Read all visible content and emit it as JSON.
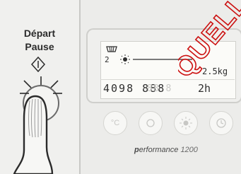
{
  "start_pause": {
    "line1": "Départ",
    "line2": "Pause"
  },
  "display": {
    "program_number": "2",
    "weight": "2.5kg",
    "digits": "4098 888",
    "ghost_digits": "88 8",
    "hours": "2h"
  },
  "buttons": [
    {
      "name": "temperature",
      "label": "°C"
    },
    {
      "name": "spin",
      "label": ""
    },
    {
      "name": "stain",
      "label": ""
    },
    {
      "name": "delay",
      "label": ""
    }
  ],
  "brand": {
    "bold": "p",
    "italic": "erformance",
    "model": "1200"
  },
  "watermark": {
    "text": "QUELLE"
  },
  "colors": {
    "watermark": "#cc1010",
    "panel": "#ececea",
    "lcd": "#fbfbf8"
  }
}
